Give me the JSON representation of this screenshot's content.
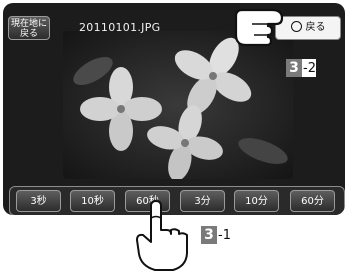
{
  "screen": {
    "home_button": [
      "現在地に",
      "戻る"
    ],
    "filename": "20110101.JPG",
    "back_label": "戻る"
  },
  "interval_buttons": [
    "3秒",
    "10秒",
    "60秒",
    "3分",
    "10分",
    "60分"
  ],
  "callouts": {
    "top": {
      "number": "3",
      "suffix": "-2"
    },
    "bottom": {
      "number": "3",
      "suffix": "-1"
    }
  },
  "icons": [
    "pointing-hand-icon",
    "pressing-finger-icon",
    "circle-dot-icon"
  ]
}
